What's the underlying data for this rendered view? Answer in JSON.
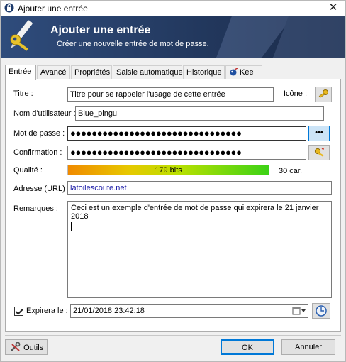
{
  "window": {
    "title": "Ajouter une entrée",
    "close_symbol": "✕"
  },
  "banner": {
    "title": "Ajouter une entrée",
    "subtitle": "Créer une nouvelle entrée de mot de passe."
  },
  "tabs": [
    {
      "label": "Entrée",
      "active": true
    },
    {
      "label": "Avancé"
    },
    {
      "label": "Propriétés"
    },
    {
      "label": "Saisie automatique"
    },
    {
      "label": "Historique"
    },
    {
      "label": "Kee"
    }
  ],
  "form": {
    "title_label": "Titre :",
    "title_value": "Titre pour se rappeler l'usage de cette entrée",
    "icon_label": "Icône :",
    "username_label": "Nom d'utilisateur :",
    "username_value": "Blue_pingu",
    "password_label": "Mot de passe :",
    "password_value": "●●●●●●●●●●●●●●●●●●●●●●●●●●●●●●●●",
    "show_password_label": "•••",
    "confirm_label": "Confirmation :",
    "confirm_value": "●●●●●●●●●●●●●●●●●●●●●●●●●●●●●●●●",
    "quality_label": "Qualité :",
    "quality_bits": "179 bits",
    "quality_chars": "30 car.",
    "quality_fraction": 1.0,
    "url_label": "Adresse (URL) :",
    "url_value": "latoilescoute.net",
    "notes_label": "Remarques :",
    "notes_value": "Ceci est un exemple d'entrée de mot de passe qui expirera le 21 janvier 2018",
    "expires_label": "Expirera le :",
    "expires_checked": true,
    "expires_value": "21/01/2018 23:42:18"
  },
  "buttons": {
    "tools": "Outils",
    "ok": "OK",
    "cancel": "Annuler"
  },
  "icons": {
    "window": "lock-icon",
    "banner": "key-pen-icon",
    "entry_icon": "key-icon",
    "generate": "key-generator-icon",
    "calendar": "calendar-icon",
    "clock": "clock-icon",
    "tools": "tools-icon",
    "kee": "kee-icon"
  }
}
